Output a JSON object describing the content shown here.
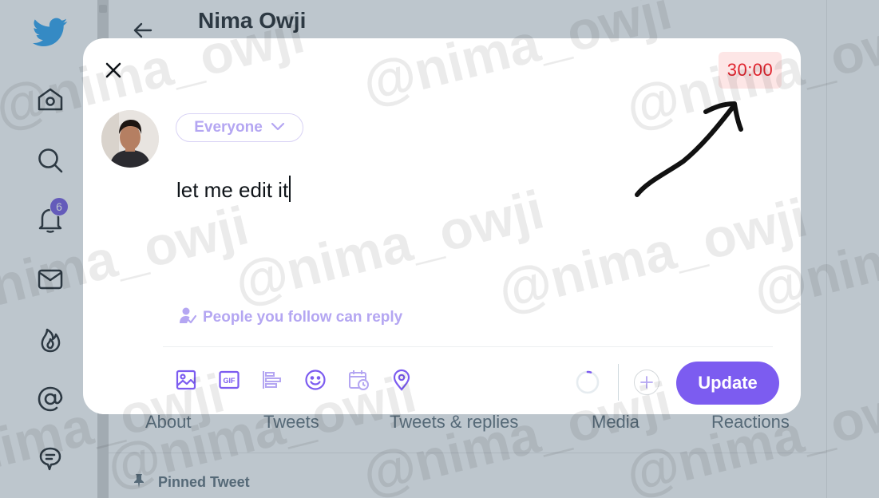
{
  "profile": {
    "name": "Nima Owji",
    "tabs": [
      "About",
      "Tweets",
      "Tweets & replies",
      "Media",
      "Reactions"
    ],
    "pinned_label": "Pinned Tweet"
  },
  "nav": {
    "notification_count": "6"
  },
  "compose": {
    "timer": "30:00",
    "audience": "Everyone",
    "text": "let me edit it",
    "reply_setting": "People you follow can reply",
    "gif_label": "GIF",
    "update_label": "Update"
  },
  "watermark_text": "@nima_owji",
  "colors": {
    "accent": "#7c5cf0",
    "accent_light": "#b4a6f2",
    "timer_text": "#e0242e",
    "timer_bg": "#fde6e6",
    "badge": "#6c4ee0"
  }
}
